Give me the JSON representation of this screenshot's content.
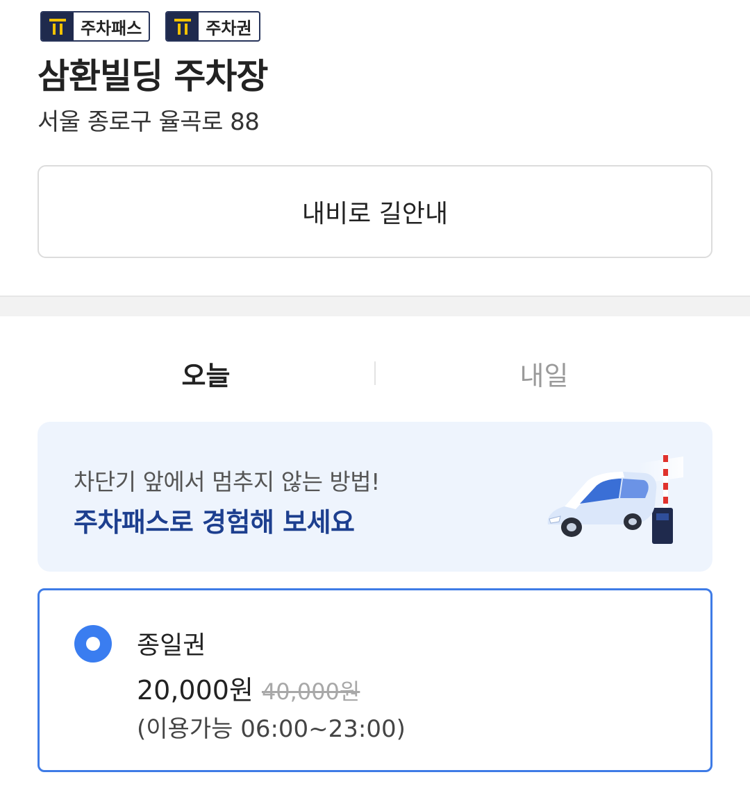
{
  "badges": [
    {
      "label": "주차패스",
      "icon": "t-logo-icon"
    },
    {
      "label": "주차권",
      "icon": "t-logo-icon"
    }
  ],
  "lot": {
    "name": "삼환빌딩 주차장",
    "address": "서울 종로구 율곡로 88"
  },
  "navigation": {
    "button_label": "내비로 길안내"
  },
  "tabs": [
    {
      "label": "오늘",
      "active": true
    },
    {
      "label": "내일",
      "active": false
    }
  ],
  "promo": {
    "subtitle": "차단기 앞에서 멈추지 않는 방법!",
    "headline": "주차패스로 경험해 보세요",
    "illustration": "car-passing-gate-icon"
  },
  "ticket": {
    "name": "종일권",
    "price": "20,000원",
    "original_price": "40,000원",
    "hours": "(이용가능 06:00~23:00)",
    "selected": true
  },
  "colors": {
    "badge_dark": "#1f2a4d",
    "badge_logo": "#f2c200",
    "promo_bg": "#eef4fd",
    "promo_headline": "#1d3f8f",
    "accent_blue": "#3a7df0"
  }
}
